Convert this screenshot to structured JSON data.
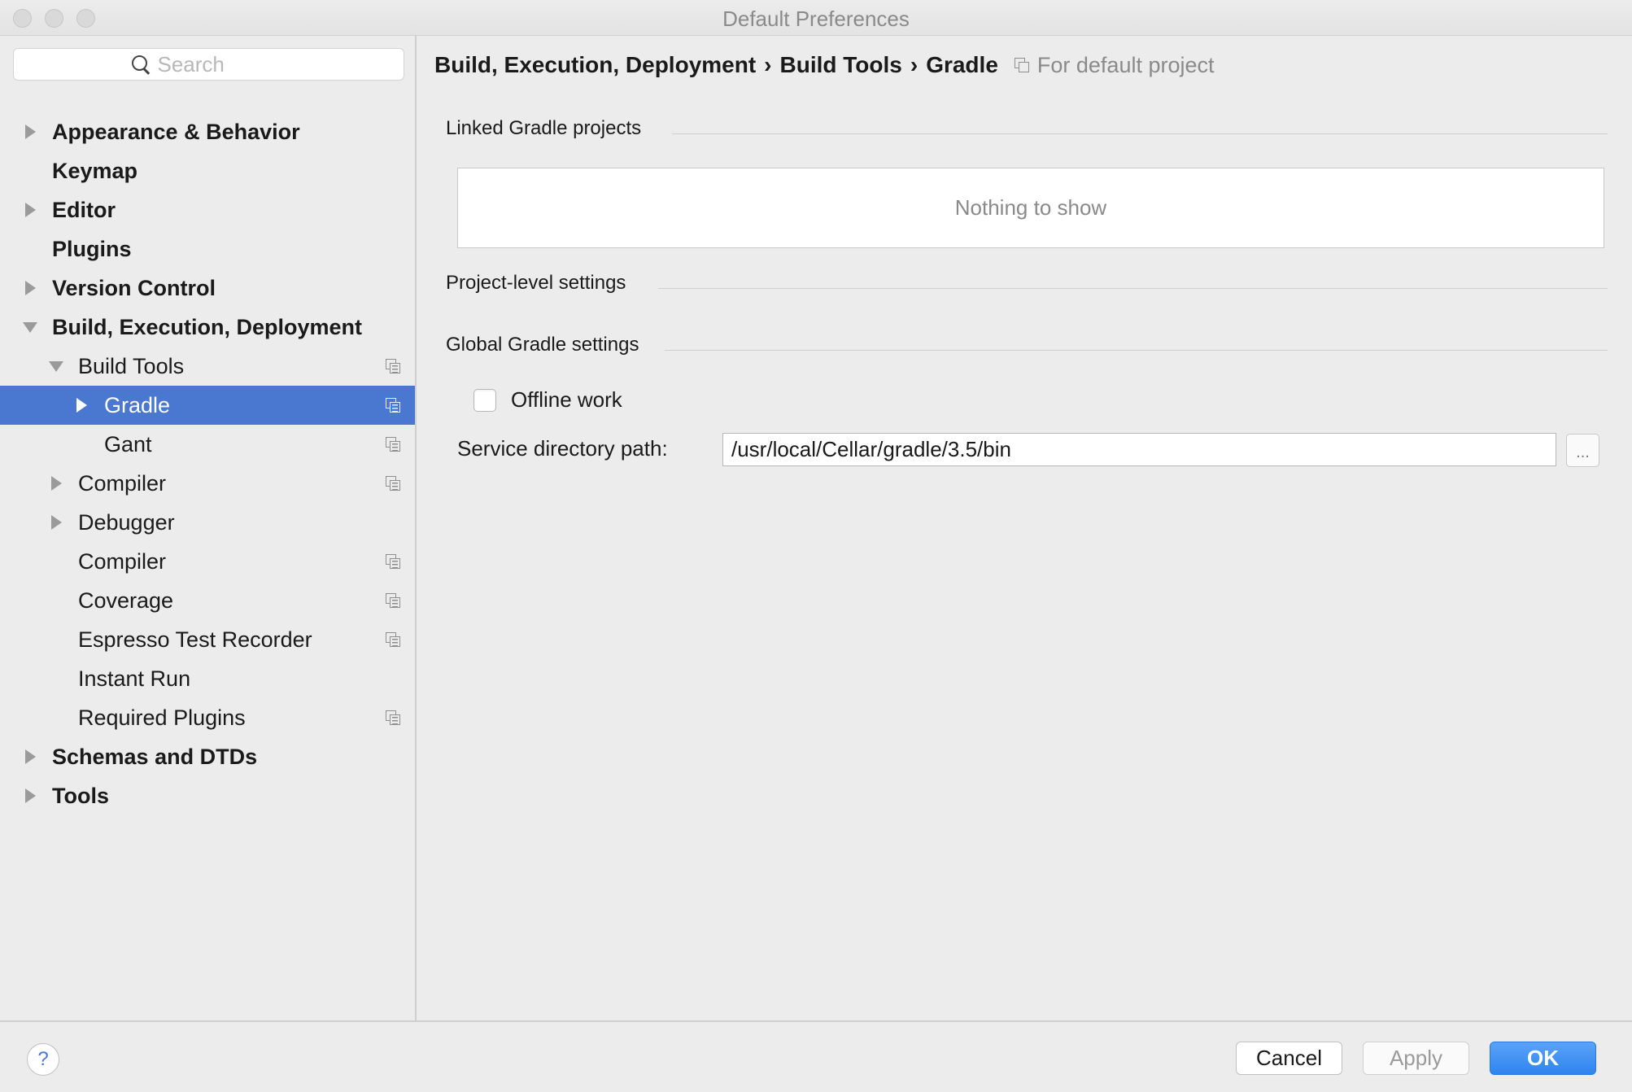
{
  "window": {
    "title": "Default Preferences"
  },
  "search": {
    "placeholder": "Search"
  },
  "sidebar": {
    "items": [
      {
        "label": "Appearance & Behavior"
      },
      {
        "label": "Keymap"
      },
      {
        "label": "Editor"
      },
      {
        "label": "Plugins"
      },
      {
        "label": "Version Control"
      },
      {
        "label": "Build, Execution, Deployment"
      },
      {
        "label": "Build Tools"
      },
      {
        "label": "Gradle"
      },
      {
        "label": "Gant"
      },
      {
        "label": "Compiler"
      },
      {
        "label": "Debugger"
      },
      {
        "label": "Compiler"
      },
      {
        "label": "Coverage"
      },
      {
        "label": "Espresso Test Recorder"
      },
      {
        "label": "Instant Run"
      },
      {
        "label": "Required Plugins"
      },
      {
        "label": "Schemas and DTDs"
      },
      {
        "label": "Tools"
      }
    ]
  },
  "breadcrumb": {
    "parts": [
      "Build, Execution, Deployment",
      "Build Tools",
      "Gradle"
    ],
    "separator": "›",
    "scope": "For default project"
  },
  "main": {
    "linked_title": "Linked Gradle projects",
    "empty_text": "Nothing to show",
    "project_title": "Project-level settings",
    "global_title": "Global Gradle settings",
    "offline_label": "Offline work",
    "service_label": "Service directory path:",
    "service_value": "/usr/local/Cellar/gradle/3.5/bin",
    "browse_label": "..."
  },
  "footer": {
    "help_label": "?",
    "cancel_label": "Cancel",
    "apply_label": "Apply",
    "ok_label": "OK"
  },
  "colors": {
    "selection": "#4a78d0",
    "ok_button": "#3b8ef3"
  }
}
